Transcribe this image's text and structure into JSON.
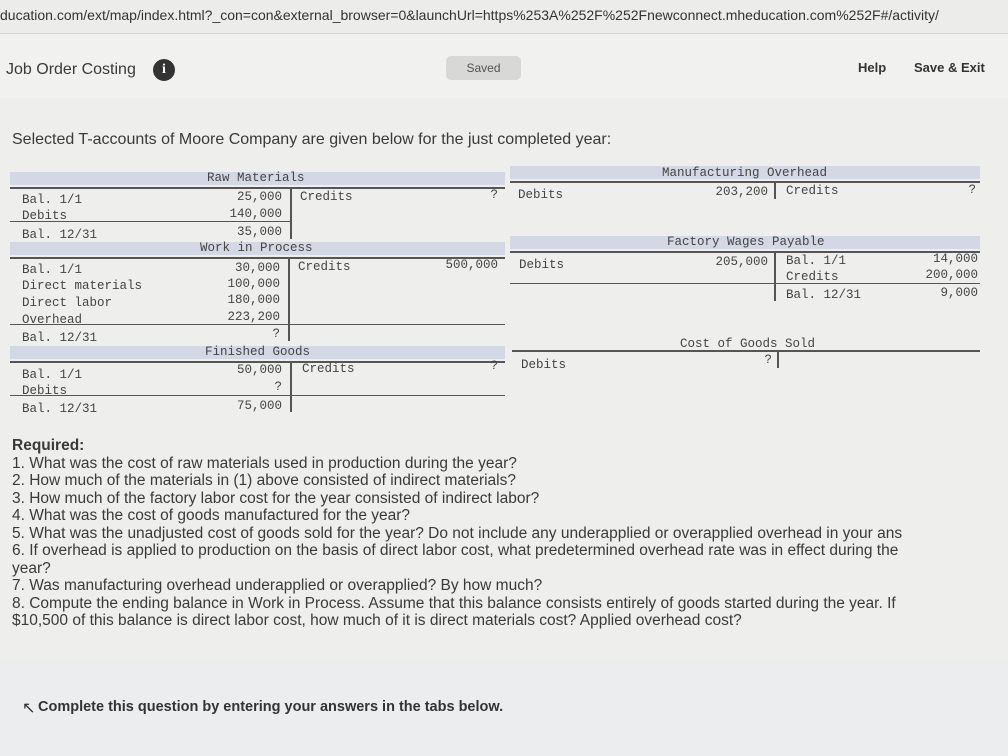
{
  "browser": {
    "url": "ducation.com/ext/map/index.html?_con=con&external_browser=0&launchUrl=https%253A%252F%252Fnewconnect.mheducation.com%252F#/activity/"
  },
  "header": {
    "title": "Job Order Costing",
    "info_icon": "i",
    "saved": "Saved",
    "help": "Help",
    "save_exit": "Save & Exit"
  },
  "intro": "Selected T-accounts of Moore Company are given below for the just completed year:",
  "accounts": {
    "raw_materials": {
      "title": "Raw Materials",
      "left_labels": [
        "Bal. 1/1",
        "Debits",
        "Bal. 12/31"
      ],
      "left_values": [
        "25,000",
        "140,000",
        "35,000"
      ],
      "credit_label": "Credits",
      "credit_value": "?"
    },
    "manufacturing_overhead": {
      "title": "Manufacturing Overhead",
      "debit_label": "Debits",
      "debit_value": "203,200",
      "credit_label": "Credits",
      "credit_value": "?"
    },
    "work_in_process": {
      "title": "Work in Process",
      "left_labels": [
        "Bal. 1/1",
        "Direct materials",
        "Direct labor",
        "Overhead",
        "Bal. 12/31"
      ],
      "left_values": [
        "30,000",
        "100,000",
        "180,000",
        "223,200",
        "?"
      ],
      "credit_label": "Credits",
      "credit_value": "500,000"
    },
    "factory_wages_payable": {
      "title": "Factory Wages Payable",
      "debit_label": "Debits",
      "debit_value": "205,000",
      "right_labels": [
        "Bal. 1/1",
        "Credits",
        "Bal. 12/31"
      ],
      "right_values": [
        "14,000",
        "200,000",
        "9,000"
      ]
    },
    "finished_goods": {
      "title": "Finished Goods",
      "left_labels": [
        "Bal. 1/1",
        "Debits",
        "Bal. 12/31"
      ],
      "left_values": [
        "50,000",
        "?",
        "75,000"
      ],
      "credit_label": "Credits",
      "credit_value": "?"
    },
    "cost_of_goods_sold": {
      "title": "Cost of Goods Sold",
      "debit_label": "Debits",
      "debit_value": "?"
    }
  },
  "required": {
    "title": "Required:",
    "items": [
      "1. What was the cost of raw materials used in production during the year?",
      "2. How much of the materials in (1) above consisted of indirect materials?",
      "3. How much of the factory labor cost for the year consisted of indirect labor?",
      "4. What was the cost of goods manufactured for the year?",
      "5. What was the unadjusted cost of goods sold for the year? Do not include any underapplied or overapplied overhead in your ans",
      "6. If overhead is applied to production on the basis of direct labor cost, what predetermined overhead rate was in effect during the",
      "year?",
      "7. Was manufacturing overhead underapplied or overapplied? By how much?",
      "8. Compute the ending balance in Work in Process. Assume that this balance consists entirely of goods started during the year. If",
      "$10,500 of this balance is direct labor cost, how much of it is direct materials cost? Applied overhead cost?"
    ]
  },
  "footer": {
    "complete": "Complete this question by entering your answers in the tabs below."
  }
}
